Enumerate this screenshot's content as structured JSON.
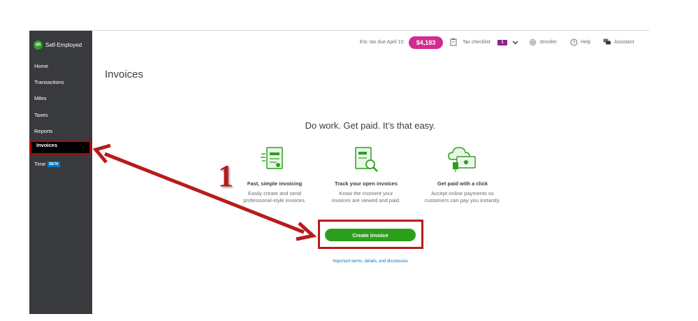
{
  "colors": {
    "sidebar": "#393a3d",
    "accent_green": "#2ca01c",
    "tax_pill": "#d52b8f",
    "annotation_red": "#b81b1b",
    "link_blue": "#0077c5"
  },
  "sidebar": {
    "brand": "Self-Employed",
    "logo": "qb",
    "items": [
      {
        "label": "Home",
        "active": false
      },
      {
        "label": "Transactions",
        "active": false
      },
      {
        "label": "Miles",
        "active": false
      },
      {
        "label": "Taxes",
        "active": false
      },
      {
        "label": "Reports",
        "active": false
      },
      {
        "label": "Invoices",
        "active": true
      },
      {
        "label": "Time",
        "badge": "BETA",
        "active": false
      }
    ]
  },
  "header": {
    "est_tax_label": "Est. tax due April 15:",
    "est_tax_amount": "$4,183",
    "tax_checklist_label": "Tax checklist",
    "tax_checklist_count": "1",
    "user_name": "Jennifer",
    "help_label": "Help",
    "assistant_label": "Assistant"
  },
  "main": {
    "title": "Invoices",
    "tagline": "Do work. Get paid. It’s that easy.",
    "features": [
      {
        "title": "Fast, simple invoicing",
        "desc_line1": "Easily create and send",
        "desc_line2": "professional-style invoices.",
        "icon": "invoice-document-icon"
      },
      {
        "title": "Track your open invoices",
        "desc_line1": "Know the moment your",
        "desc_line2": "invoices are viewed and paid.",
        "icon": "invoice-search-icon"
      },
      {
        "title": "Get paid with a click",
        "desc_line1": "Accept online payments so",
        "desc_line2": "customers can pay you instantly.",
        "icon": "cloud-payment-icon"
      }
    ],
    "create_button": "Create invoice",
    "disclosure_link": "Important terms, details, and disclosures"
  },
  "annotation": {
    "step_number": "1"
  }
}
